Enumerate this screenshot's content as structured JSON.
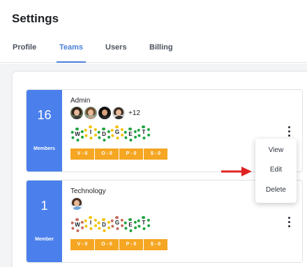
{
  "page": {
    "title": "Settings"
  },
  "tabs": [
    {
      "label": "Profile",
      "active": false
    },
    {
      "label": "Teams",
      "active": true
    },
    {
      "label": "Users",
      "active": false
    },
    {
      "label": "Billing",
      "active": false
    }
  ],
  "colors": {
    "accent": "#4a7fd7",
    "count_block": "#4b80ec",
    "stat_badge": "#f5a623",
    "arrow": "#e02424",
    "gear_green": "#1fa13f",
    "gear_yellow": "#f2c200",
    "gear_red": "#c46b5a"
  },
  "teams": [
    {
      "count": "16",
      "count_label": "Members",
      "name": "Admin",
      "extra_members": "+12",
      "gears": [
        "W",
        "I",
        "D",
        "G",
        "E",
        "T"
      ],
      "stats": [
        "V - 0",
        "O - 0",
        "P - 0",
        "$ - 0"
      ]
    },
    {
      "count": "1",
      "count_label": "Member",
      "name": "Technology",
      "gears": [
        "W",
        "I",
        "D",
        "G",
        "E",
        "T"
      ],
      "stats": [
        "V - 0",
        "O - 0",
        "P - 0",
        "$ - 0"
      ]
    }
  ],
  "menu": {
    "items": [
      "View",
      "Edit",
      "Delete"
    ]
  },
  "icons": {
    "more": "kebab-icon",
    "arrow": "arrow-icon",
    "avatar": "avatar-icon",
    "gear": "gear-icon"
  }
}
